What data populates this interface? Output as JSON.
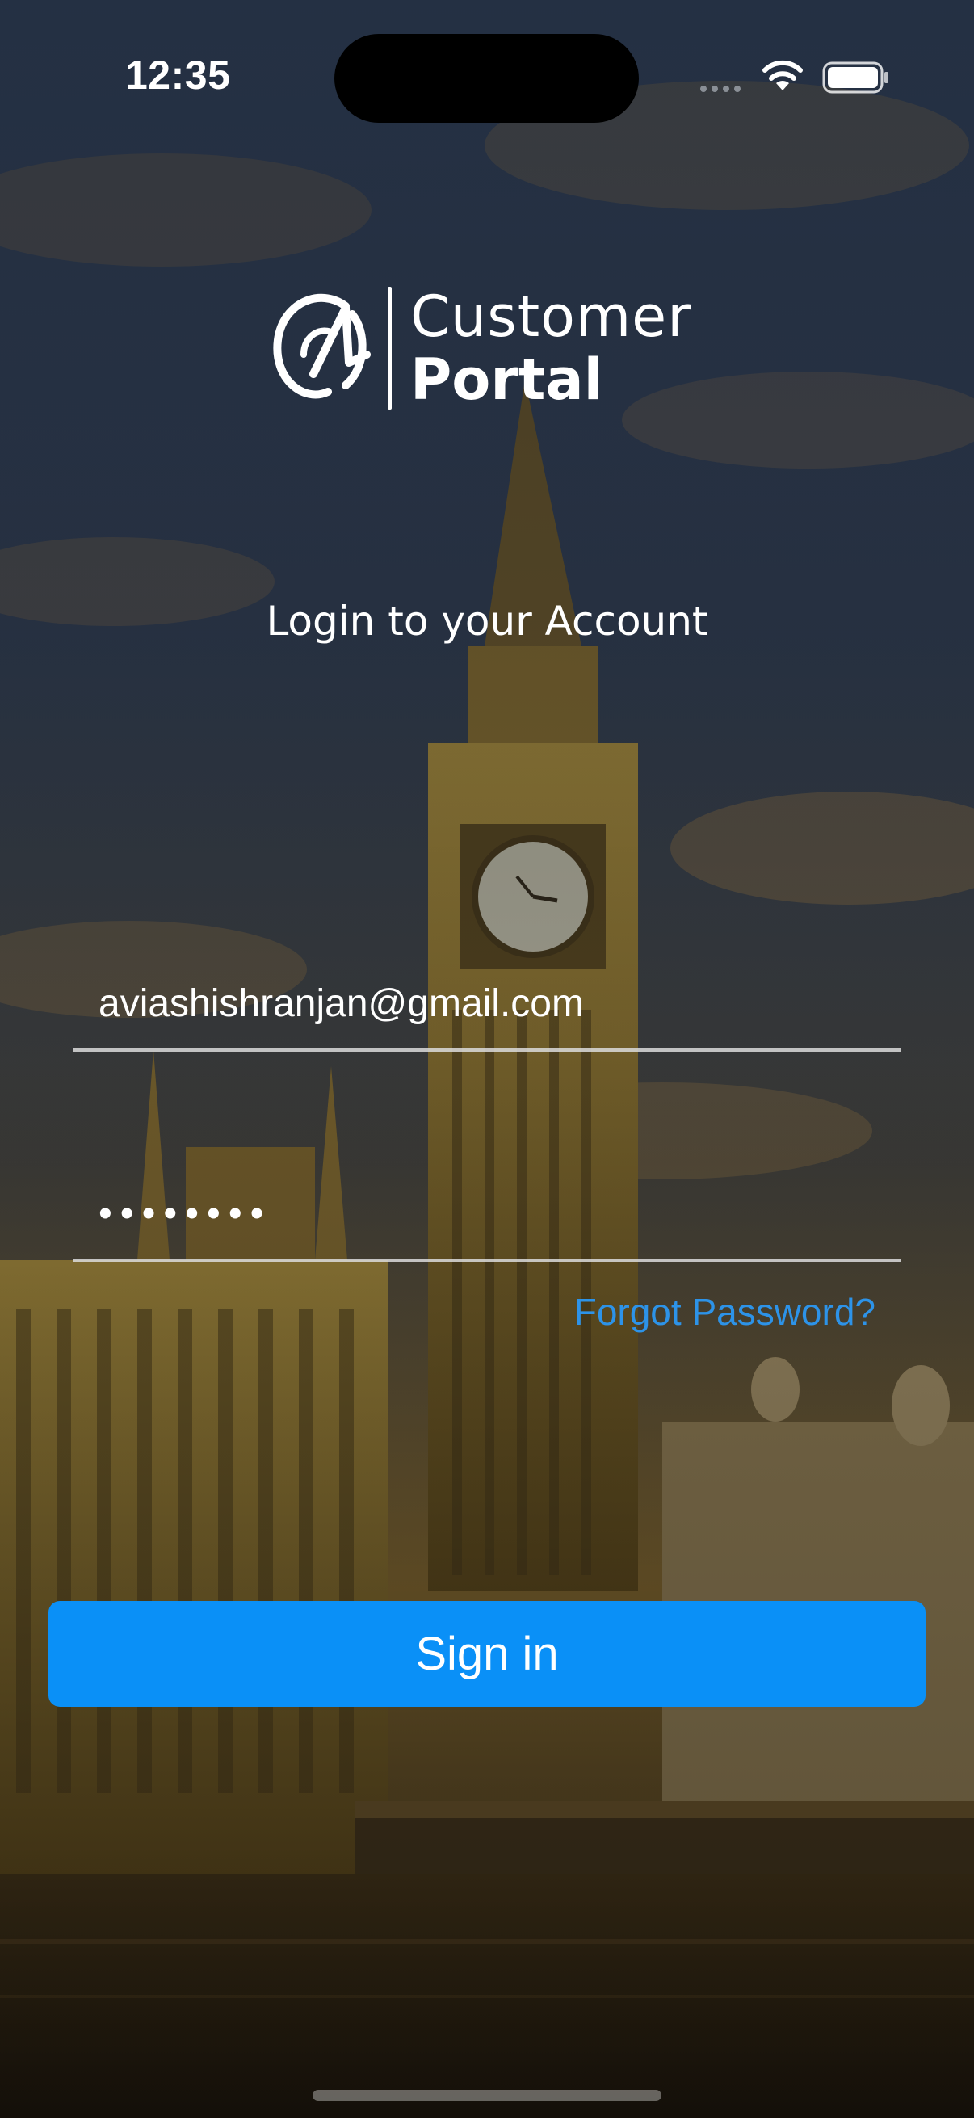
{
  "status_bar": {
    "time": "12:35"
  },
  "logo": {
    "line1": "Customer",
    "line2": "Portal"
  },
  "heading": "Login to your Account",
  "form": {
    "email_value": "aviashishranjan@gmail.com",
    "password_value": "••••••••"
  },
  "forgot_password": "Forgot Password?",
  "sign_in_label": "Sign in",
  "colors": {
    "accent": "#0a90f7",
    "link": "#2d93e8"
  }
}
